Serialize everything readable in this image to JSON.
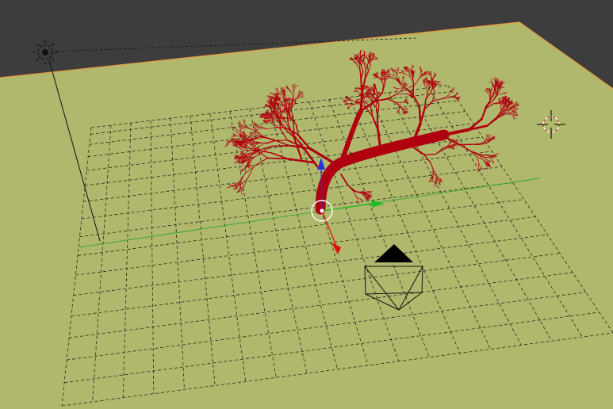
{
  "viewport": {
    "view_type": "3D viewport",
    "background_color": "#3d3d3d",
    "ground_color": "#b0b86d",
    "ground_edge_color": "#e89a3c",
    "grid_color": "#2a2a1e"
  },
  "objects": {
    "lamp": {
      "icon": "sun-lamp-icon",
      "color": "#111111"
    },
    "tree": {
      "icon": "tree-mesh",
      "color": "#b00010"
    },
    "camera": {
      "icon": "camera-icon",
      "color": "#000000"
    },
    "cursor": {
      "icon": "3d-cursor-icon",
      "color": "#cc3333"
    }
  },
  "gizmo": {
    "x_axis_color": "#dd1111",
    "y_axis_color": "#22bb22",
    "z_axis_color": "#2233dd",
    "pivot_color": "#ffffff"
  }
}
